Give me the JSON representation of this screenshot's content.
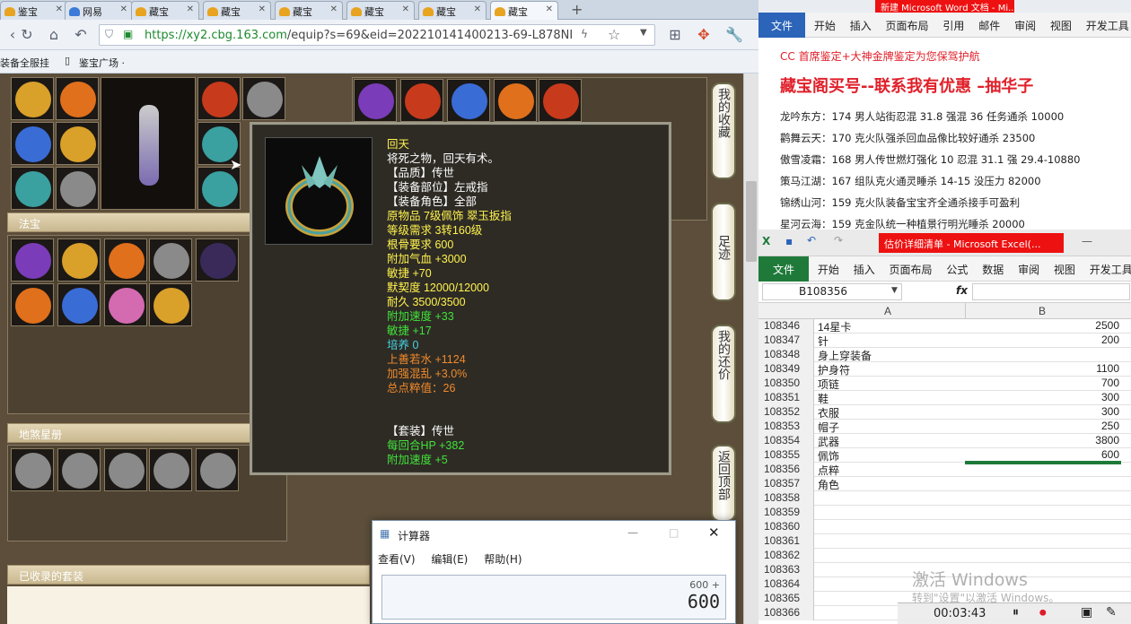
{
  "browser": {
    "tabs": [
      "鉴宝",
      "网易",
      "藏宝",
      "藏宝",
      "藏宝",
      "藏宝",
      "藏宝",
      "藏宝"
    ],
    "new_tab": "+",
    "url_prefix": "https://",
    "url_host": "xy2.cbg.163.com",
    "url_path": "/equip?s=69&eid=202210141400213-69-L878NI",
    "bookmarks": [
      "装备全服挂",
      "鉴宝广场 ·"
    ]
  },
  "page": {
    "section_fabao": "法宝",
    "section_disha": "地煞星册",
    "section_suits": "已收录的套装",
    "side_buttons": [
      "我的收藏",
      "足迹",
      "我的还价",
      "返回顶部"
    ],
    "item_colors": {
      "gold": "#d9a02a",
      "orange": "#e0701c",
      "red": "#c73a1c",
      "blue": "#3a6cd6",
      "purple": "#7a3cb8",
      "teal": "#3aa0a0",
      "pink": "#d46ab0",
      "gray": "#8a8a8a"
    }
  },
  "tooltip": {
    "name": "回天",
    "desc": "将死之物，回天有术。",
    "quality": "【品质】传世",
    "slot": "【装备部位】左戒指",
    "role": "【装备角色】全部",
    "origin": "原物品 7级佩饰 翠玉扳指",
    "level_req": "等级需求 3转160级",
    "bone_req": "根骨要求 600",
    "hp": "附加气血 +3000",
    "agi": "敏捷 +70",
    "bond": "默契度 12000/12000",
    "durability": "耐久 3500/3500",
    "speed": "附加速度 +33",
    "agi2": "敏捷 +17",
    "culture": "培养 0",
    "water": "上善若水 +1124",
    "confuse": "加强混乱 +3.0%",
    "total": "总点粹值：26",
    "suit": "【套装】传世",
    "suit_hp": "每回合HP +382",
    "suit_speed": "附加速度 +5"
  },
  "calc": {
    "title": "计算器",
    "menu": [
      "查看(V)",
      "编辑(E)",
      "帮助(H)"
    ],
    "history": "600 +",
    "value": "600"
  },
  "word": {
    "title": "新建 Microsoft Word 文档 - Mi...",
    "ribbon": [
      "文件",
      "开始",
      "插入",
      "页面布局",
      "引用",
      "邮件",
      "审阅",
      "视图",
      "开发工具"
    ],
    "line1": "CC 首席鉴定+大神金牌鉴定为您保驾护航",
    "line2": "藏宝阁买号--联系我有优惠 –抽华子",
    "lines": [
      "龙吟东方：174 男人站街忍混 31.8 强混 36 任务通杀 10000",
      "鹳舞云天：170 克火队强杀回血品像比较好通杀 23500",
      "傲雪凌霜：168 男人传世燃灯强化 10 忍混 31.1 强 29.4-10880",
      "策马江湖：167 组队克火通灵睡杀 14-15 没压力 82000",
      "锦绣山河：159 克火队装备宝宝齐全通杀接手可盈利",
      "星河云海：159 克金队统一种植景行明光睡杀 20000"
    ]
  },
  "excel": {
    "title": "估价详细清单 - Microsoft Excel(...",
    "ribbon": [
      "文件",
      "开始",
      "插入",
      "页面布局",
      "公式",
      "数据",
      "审阅",
      "视图",
      "开发工具"
    ],
    "name_box": "B108356",
    "fx": "fx",
    "col_a": "A",
    "col_b": "B",
    "rows": [
      {
        "n": "108346",
        "a": "14星卡",
        "b": "2500"
      },
      {
        "n": "108347",
        "a": "针",
        "b": "200"
      },
      {
        "n": "108348",
        "a": "身上穿装备",
        "b": ""
      },
      {
        "n": "108349",
        "a": "护身符",
        "b": "1100"
      },
      {
        "n": "108350",
        "a": "项链",
        "b": "700"
      },
      {
        "n": "108351",
        "a": "鞋",
        "b": "300"
      },
      {
        "n": "108352",
        "a": "衣服",
        "b": "300"
      },
      {
        "n": "108353",
        "a": "帽子",
        "b": "250"
      },
      {
        "n": "108354",
        "a": "武器",
        "b": "3800"
      },
      {
        "n": "108355",
        "a": "佩饰",
        "b": "600"
      },
      {
        "n": "108356",
        "a": "点粹",
        "b": ""
      },
      {
        "n": "108357",
        "a": "角色",
        "b": ""
      },
      {
        "n": "108358",
        "a": "",
        "b": ""
      },
      {
        "n": "108359",
        "a": "",
        "b": ""
      },
      {
        "n": "108360",
        "a": "",
        "b": ""
      },
      {
        "n": "108361",
        "a": "",
        "b": ""
      },
      {
        "n": "108362",
        "a": "",
        "b": ""
      },
      {
        "n": "108363",
        "a": "",
        "b": ""
      },
      {
        "n": "108364",
        "a": "",
        "b": ""
      },
      {
        "n": "108365",
        "a": "",
        "b": ""
      },
      {
        "n": "108366",
        "a": "",
        "b": ""
      }
    ]
  },
  "overlay": {
    "activate": "激活 Windows",
    "activate_sub": "转到\"设置\"以激活 Windows。",
    "timer": "00:03:43"
  }
}
